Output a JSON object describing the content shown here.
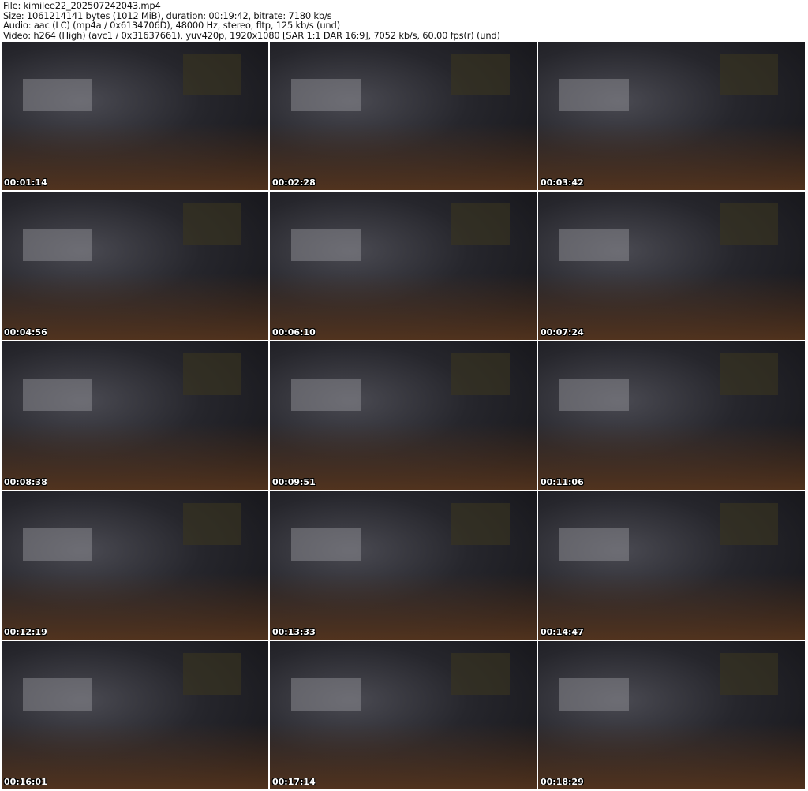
{
  "header": {
    "file": "File: kimilee22_202507242043.mp4",
    "size": "Size: 1061214141 bytes (1012 MiB), duration: 00:19:42, bitrate: 7180 kb/s",
    "audio": "Audio: aac (LC) (mp4a / 0x6134706D), 48000 Hz, stereo, fltp, 125 kb/s (und)",
    "video": "Video: h264 (High) (avc1 / 0x31637661), yuv420p, 1920x1080 [SAR 1:1 DAR 16:9], 7052 kb/s, 60.00 fps(r) (und)"
  },
  "thumbnails": [
    {
      "timestamp": "00:01:14"
    },
    {
      "timestamp": "00:02:28"
    },
    {
      "timestamp": "00:03:42"
    },
    {
      "timestamp": "00:04:56"
    },
    {
      "timestamp": "00:06:10"
    },
    {
      "timestamp": "00:07:24"
    },
    {
      "timestamp": "00:08:38"
    },
    {
      "timestamp": "00:09:51"
    },
    {
      "timestamp": "00:11:06"
    },
    {
      "timestamp": "00:12:19"
    },
    {
      "timestamp": "00:13:33"
    },
    {
      "timestamp": "00:14:47"
    },
    {
      "timestamp": "00:16:01"
    },
    {
      "timestamp": "00:17:14"
    },
    {
      "timestamp": "00:18:29"
    }
  ]
}
